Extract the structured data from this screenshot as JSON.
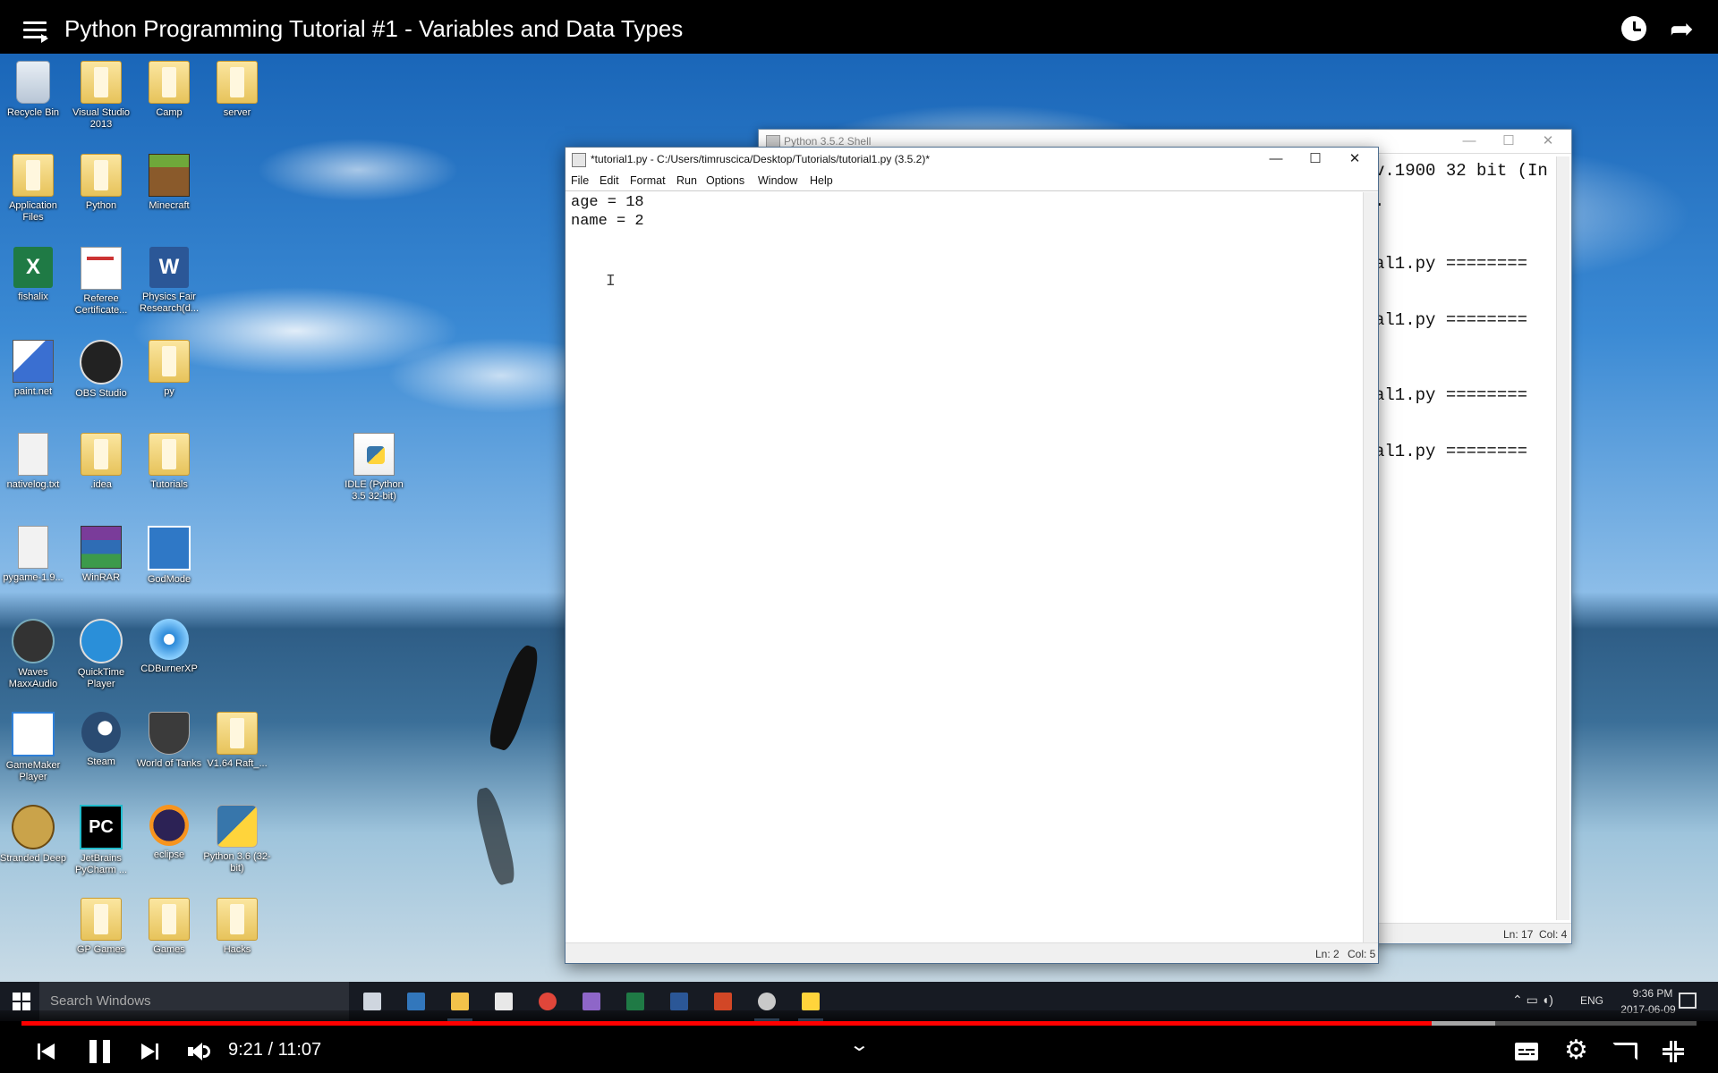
{
  "video": {
    "title": "Python Programming Tutorial #1 - Variables and Data Types",
    "current_time": "9:21",
    "duration": "11:07",
    "time_display": "9:21 / 11:07",
    "progress_fraction": 0.842,
    "buffered_fraction": 0.88,
    "progress_color": "#ff0000"
  },
  "desktop": {
    "icons": [
      {
        "label": "Recycle Bin",
        "icon": "recycle-bin-icon"
      },
      {
        "label": "Visual Studio 2013",
        "icon": "folder-icon"
      },
      {
        "label": "Camp",
        "icon": "folder-icon"
      },
      {
        "label": "server",
        "icon": "folder-icon"
      },
      {
        "label": "Application Files",
        "icon": "folder-icon"
      },
      {
        "label": "Python",
        "icon": "folder-icon"
      },
      {
        "label": "Minecraft",
        "icon": "minecraft-icon"
      },
      {
        "label": "fishalix",
        "icon": "excel-icon"
      },
      {
        "label": "Referee Certificate...",
        "icon": "certificate-icon"
      },
      {
        "label": "Physics Fair Research(d...",
        "icon": "word-icon"
      },
      {
        "label": "paint.net",
        "icon": "paintnet-icon"
      },
      {
        "label": "OBS Studio",
        "icon": "obs-icon"
      },
      {
        "label": "py",
        "icon": "folder-icon"
      },
      {
        "label": "nativelog.txt",
        "icon": "text-file-icon"
      },
      {
        "label": ".idea",
        "icon": "folder-icon"
      },
      {
        "label": "Tutorials",
        "icon": "folder-icon"
      },
      {
        "label": "IDLE (Python 3.5 32-bit)",
        "icon": "idle-icon"
      },
      {
        "label": "pygame-1.9...",
        "icon": "text-file-icon"
      },
      {
        "label": "WinRAR",
        "icon": "winrar-icon"
      },
      {
        "label": "GodMode",
        "icon": "godmode-icon"
      },
      {
        "label": "Waves MaxxAudio",
        "icon": "waves-icon"
      },
      {
        "label": "QuickTime Player",
        "icon": "quicktime-icon"
      },
      {
        "label": "CDBurnerXP",
        "icon": "cdburner-icon"
      },
      {
        "label": "GameMaker Player",
        "icon": "gamemaker-icon"
      },
      {
        "label": "Steam",
        "icon": "steam-icon"
      },
      {
        "label": "World of Tanks",
        "icon": "world-of-tanks-icon"
      },
      {
        "label": "V1.64 Raft_...",
        "icon": "folder-icon"
      },
      {
        "label": "Stranded Deep",
        "icon": "stranded-deep-icon"
      },
      {
        "label": "JetBrains PyCharm ...",
        "icon": "pycharm-icon"
      },
      {
        "label": "eclipse",
        "icon": "eclipse-icon"
      },
      {
        "label": "Python 3.6 (32-bit)",
        "icon": "python-icon"
      },
      {
        "label": "GP Games",
        "icon": "folder-icon"
      },
      {
        "label": "Games",
        "icon": "folder-icon"
      },
      {
        "label": "Hacks",
        "icon": "folder-icon"
      }
    ]
  },
  "shell_window": {
    "title": "Python 3.5.2 Shell",
    "lines": [
      "v.1900 32 bit (In",
      ".",
      "al1.py ========",
      "al1.py ========",
      "al1.py ========",
      "al1.py ========"
    ],
    "status_ln": "Ln: 17",
    "status_col": "Col: 4"
  },
  "editor_window": {
    "title": "*tutorial1.py - C:/Users/timruscica/Desktop/Tutorials/tutorial1.py (3.5.2)*",
    "menu": [
      "File",
      "Edit",
      "Format",
      "Run",
      "Options",
      "Window",
      "Help"
    ],
    "code_lines": [
      "age = 18",
      "name = 2"
    ],
    "status_ln": "Ln: 2",
    "status_col": "Col: 5"
  },
  "taskbar": {
    "search_placeholder": "Search Windows",
    "apps": [
      {
        "name": "task-view-icon",
        "active": false
      },
      {
        "name": "edge-icon",
        "active": false
      },
      {
        "name": "file-explorer-icon",
        "active": true
      },
      {
        "name": "store-icon",
        "active": false
      },
      {
        "name": "chrome-icon",
        "active": false
      },
      {
        "name": "visual-studio-icon",
        "active": false
      },
      {
        "name": "excel-icon",
        "active": false
      },
      {
        "name": "word-icon",
        "active": false
      },
      {
        "name": "powerpoint-icon",
        "active": false
      },
      {
        "name": "obs-icon",
        "active": true
      },
      {
        "name": "idle-icon",
        "active": true
      }
    ],
    "language": "ENG",
    "time": "9:36 PM",
    "date": "2017-06-09"
  },
  "colors": {
    "accent": "#ff0000",
    "taskbar": "#181c24"
  }
}
